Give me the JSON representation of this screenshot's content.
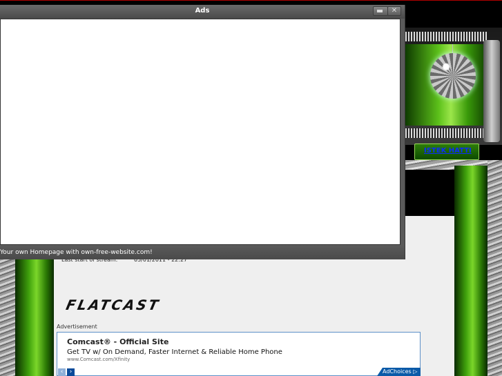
{
  "window": {
    "title": "Ads",
    "close_glyph": "✕",
    "status": "Your own Homepage with own-free-website.com!"
  },
  "site": {
    "nav_link": "ISTEK HATTI",
    "stream_label": "Last start of stream:",
    "stream_value": "05/01/2011 - 22:27",
    "logo_text": "FLATCAST",
    "advertisement_label": "Advertisement"
  },
  "ad": {
    "title": "Comcast® - Official Site",
    "description": "Get TV w/ On Demand, Faster Internet & Reliable Home Phone",
    "url": "www.Comcast.com/Xfinity",
    "adchoices": "AdChoices ▷",
    "prev_glyph": "‹",
    "next_glyph": "›"
  },
  "colors": {
    "accent_green": "#5cc01a",
    "ad_border": "#5b8fc7",
    "adchoices_bg": "#0a5aa8",
    "link": "#0a2cff"
  },
  "icons": [
    "minimize-icon",
    "close-icon",
    "disco-ball-icon",
    "chevron-left-icon",
    "chevron-right-icon"
  ]
}
